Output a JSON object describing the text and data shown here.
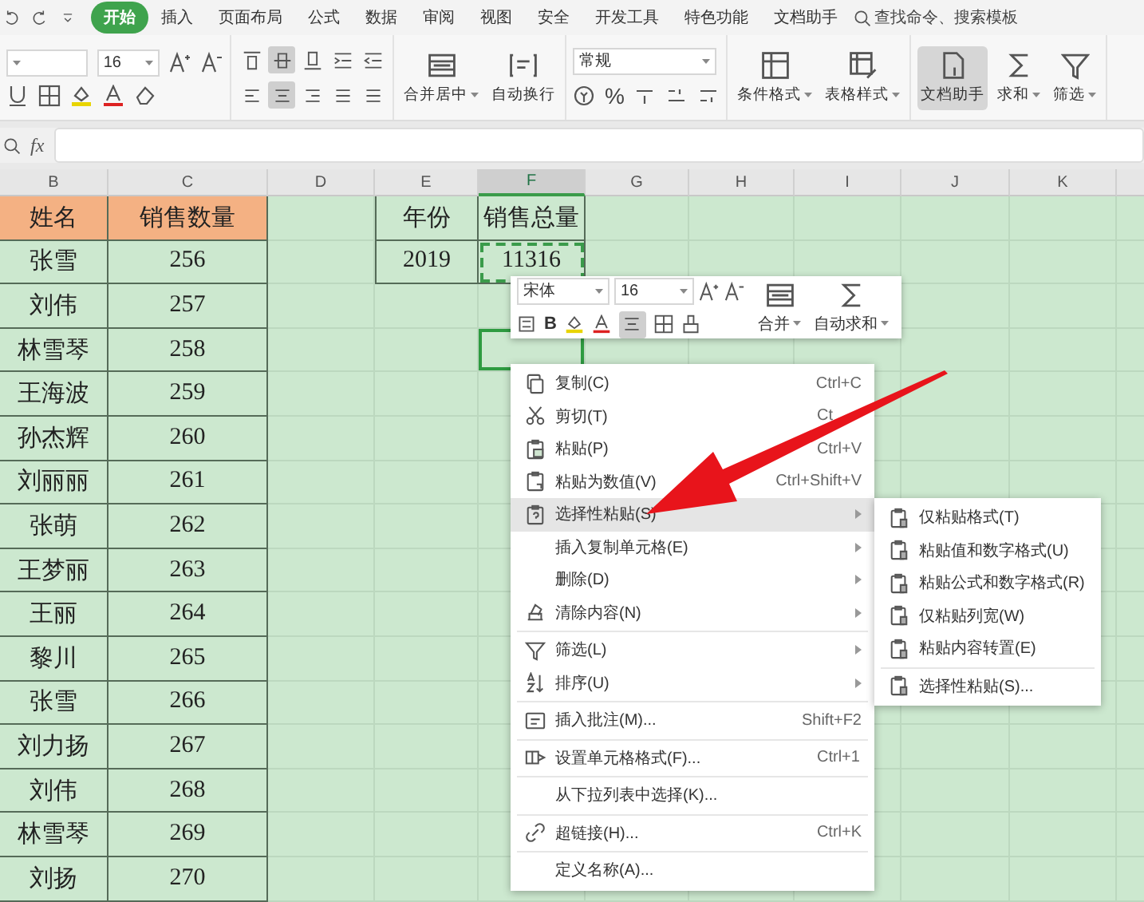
{
  "tabs": [
    {
      "label": "开始",
      "selected": true
    },
    {
      "label": "插入",
      "selected": false
    },
    {
      "label": "页面布局",
      "selected": false
    },
    {
      "label": "公式",
      "selected": false
    },
    {
      "label": "数据",
      "selected": false
    },
    {
      "label": "审阅",
      "selected": false
    },
    {
      "label": "视图",
      "selected": false
    },
    {
      "label": "安全",
      "selected": false
    },
    {
      "label": "开发工具",
      "selected": false
    },
    {
      "label": "特色功能",
      "selected": false
    },
    {
      "label": "文档助手",
      "selected": false
    }
  ],
  "search": {
    "label": "查找命令、搜索模板"
  },
  "ribbon": {
    "font_size": "16",
    "number_format": "常规",
    "percent": "%",
    "align_top": [
      {
        "selected": false
      },
      {
        "selected": true
      },
      {
        "selected": false
      },
      {
        "selected": false
      },
      {
        "selected": false
      }
    ],
    "align_bottom": [
      {
        "selected": false
      },
      {
        "selected": true
      },
      {
        "selected": false
      },
      {
        "selected": false
      },
      {
        "selected": false
      }
    ],
    "buttons": [
      {
        "label": "合并居中",
        "dropdown": true,
        "selected": false
      },
      {
        "label": "自动换行",
        "dropdown": false,
        "selected": false
      },
      {
        "label": "条件格式",
        "dropdown": true,
        "selected": false
      },
      {
        "label": "表格样式",
        "dropdown": true,
        "selected": false
      },
      {
        "label": "文档助手",
        "dropdown": false,
        "selected": true
      },
      {
        "label": "求和",
        "dropdown": true,
        "selected": false
      },
      {
        "label": "筛选",
        "dropdown": true,
        "selected": false
      }
    ]
  },
  "formula_bar": {
    "fx": "fx"
  },
  "sheet": {
    "columns": [
      {
        "label": "B",
        "selected": false
      },
      {
        "label": "C",
        "selected": false
      },
      {
        "label": "D",
        "selected": false
      },
      {
        "label": "E",
        "selected": false
      },
      {
        "label": "F",
        "selected": true
      },
      {
        "label": "G",
        "selected": false
      },
      {
        "label": "H",
        "selected": false
      },
      {
        "label": "I",
        "selected": false
      },
      {
        "label": "J",
        "selected": false
      },
      {
        "label": "K",
        "selected": false
      }
    ],
    "rows": [
      {
        "selected": false
      },
      {
        "selected": false
      },
      {
        "selected": false
      },
      {
        "selected": true
      },
      {
        "selected": false
      },
      {
        "selected": false
      },
      {
        "selected": false
      },
      {
        "selected": false
      },
      {
        "selected": false
      },
      {
        "selected": false
      },
      {
        "selected": false
      },
      {
        "selected": false
      },
      {
        "selected": false
      },
      {
        "selected": false
      },
      {
        "selected": false
      },
      {
        "selected": false
      }
    ]
  },
  "table": {
    "columns": [
      "姓名",
      "销售数量"
    ],
    "rows": [
      [
        "张雪",
        "256"
      ],
      [
        "刘伟",
        "257"
      ],
      [
        "林雪琴",
        "258"
      ],
      [
        "王海波",
        "259"
      ],
      [
        "孙杰辉",
        "260"
      ],
      [
        "刘丽丽",
        "261"
      ],
      [
        "张萌",
        "262"
      ],
      [
        "王梦丽",
        "263"
      ],
      [
        "王丽",
        "264"
      ],
      [
        "黎川",
        "265"
      ],
      [
        "张雪",
        "266"
      ],
      [
        "刘力扬",
        "267"
      ],
      [
        "刘伟",
        "268"
      ],
      [
        "林雪琴",
        "269"
      ],
      [
        "刘扬",
        "270"
      ]
    ]
  },
  "summary": {
    "columns": [
      "年份",
      "销售总量"
    ],
    "rows": [
      {
        "year": "2019",
        "total": "11316",
        "copied": true
      }
    ]
  },
  "mini_toolbar": {
    "font": "宋体",
    "size": "16",
    "bold": "B",
    "align_selected": true,
    "buttons": [
      {
        "label": "合并"
      },
      {
        "label": "自动求和"
      }
    ]
  },
  "context_menu": {
    "groups": [
      [
        {
          "label": "复制(C)",
          "kind": "shortcut",
          "shortcut": "Ctrl+C",
          "selected": false
        },
        {
          "label": "剪切(T)",
          "kind": "shortcut",
          "shortcut": "Ct",
          "selected": false
        },
        {
          "label": "粘贴(P)",
          "kind": "shortcut",
          "shortcut": "Ctrl+V",
          "selected": false
        },
        {
          "label": "粘贴为数值(V)",
          "kind": "shortcut",
          "shortcut": "Ctrl+Shift+V",
          "selected": false
        },
        {
          "label": "选择性粘贴(S)",
          "kind": "submenu",
          "selected": true
        },
        {
          "label": "插入复制单元格(E)",
          "kind": "submenu",
          "selected": false
        },
        {
          "label": "删除(D)",
          "kind": "submenu",
          "selected": false
        },
        {
          "label": "清除内容(N)",
          "kind": "submenu",
          "selected": false
        }
      ],
      [
        {
          "label": "筛选(L)",
          "kind": "submenu",
          "selected": false
        },
        {
          "label": "排序(U)",
          "kind": "submenu",
          "selected": false
        }
      ],
      [
        {
          "label": "插入批注(M)...",
          "kind": "shortcut",
          "shortcut": "Shift+F2",
          "selected": false
        }
      ],
      [
        {
          "label": "设置单元格格式(F)...",
          "kind": "shortcut",
          "shortcut": "Ctrl+1",
          "selected": false
        }
      ],
      [
        {
          "label": "从下拉列表中选择(K)...",
          "kind": "plain",
          "selected": false
        }
      ],
      [
        {
          "label": "超链接(H)...",
          "kind": "shortcut",
          "shortcut": "Ctrl+K",
          "selected": false
        }
      ],
      [
        {
          "label": "定义名称(A)...",
          "kind": "plain",
          "selected": false
        }
      ]
    ]
  },
  "submenu": {
    "groups": [
      [
        {
          "label": "仅粘贴格式(T)",
          "selected": false
        },
        {
          "label": "粘贴值和数字格式(U)",
          "selected": false
        },
        {
          "label": "粘贴公式和数字格式(R)",
          "selected": false
        },
        {
          "label": "仅粘贴列宽(W)",
          "selected": false
        },
        {
          "label": "粘贴内容转置(E)",
          "selected": false
        }
      ],
      [
        {
          "label": "选择性粘贴(S)...",
          "selected": false
        }
      ]
    ]
  }
}
